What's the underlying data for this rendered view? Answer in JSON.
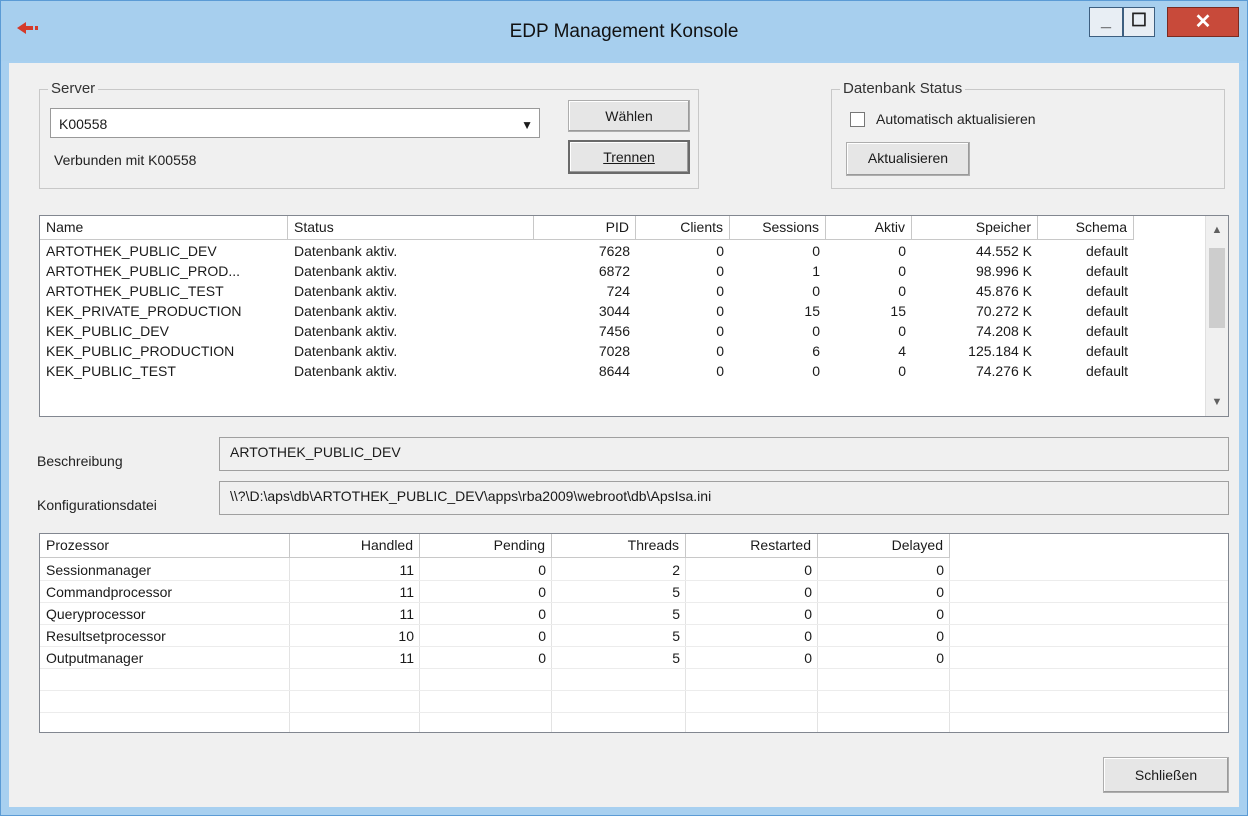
{
  "window": {
    "title": "EDP Management Konsole",
    "icon": "app-arrow-icon"
  },
  "server_group": {
    "label": "Server",
    "combo_value": "K00558",
    "connected_text": "Verbunden mit K00558",
    "select_button": "Wählen",
    "disconnect_button": "Trennen"
  },
  "db_status_group": {
    "label": "Datenbank Status",
    "auto_refresh_label": "Automatisch aktualisieren",
    "auto_refresh_checked": false,
    "refresh_button": "Aktualisieren"
  },
  "databases": {
    "columns": [
      "Name",
      "Status",
      "PID",
      "Clients",
      "Sessions",
      "Aktiv",
      "Speicher",
      "Schema"
    ],
    "rows": [
      [
        "ARTOTHEK_PUBLIC_DEV",
        "Datenbank aktiv.",
        "7628",
        "0",
        "0",
        "0",
        "44.552 K",
        "default"
      ],
      [
        "ARTOTHEK_PUBLIC_PROD...",
        "Datenbank aktiv.",
        "6872",
        "0",
        "1",
        "0",
        "98.996 K",
        "default"
      ],
      [
        "ARTOTHEK_PUBLIC_TEST",
        "Datenbank aktiv.",
        "724",
        "0",
        "0",
        "0",
        "45.876 K",
        "default"
      ],
      [
        "KEK_PRIVATE_PRODUCTION",
        "Datenbank aktiv.",
        "3044",
        "0",
        "15",
        "15",
        "70.272 K",
        "default"
      ],
      [
        "KEK_PUBLIC_DEV",
        "Datenbank aktiv.",
        "7456",
        "0",
        "0",
        "0",
        "74.208 K",
        "default"
      ],
      [
        "KEK_PUBLIC_PRODUCTION",
        "Datenbank aktiv.",
        "7028",
        "0",
        "6",
        "4",
        "125.184 K",
        "default"
      ],
      [
        "KEK_PUBLIC_TEST",
        "Datenbank aktiv.",
        "8644",
        "0",
        "0",
        "0",
        "74.276 K",
        "default"
      ]
    ]
  },
  "description": {
    "label": "Beschreibung",
    "value": "ARTOTHEK_PUBLIC_DEV"
  },
  "config_file": {
    "label": "Konfigurationsdatei",
    "value": "\\\\?\\D:\\aps\\db\\ARTOTHEK_PUBLIC_DEV\\apps\\rba2009\\webroot\\db\\ApsIsa.ini"
  },
  "processors": {
    "columns": [
      "Prozessor",
      "Handled",
      "Pending",
      "Threads",
      "Restarted",
      "Delayed"
    ],
    "rows": [
      [
        "Sessionmanager",
        "11",
        "0",
        "2",
        "0",
        "0"
      ],
      [
        "Commandprocessor",
        "11",
        "0",
        "5",
        "0",
        "0"
      ],
      [
        "Queryprocessor",
        "11",
        "0",
        "5",
        "0",
        "0"
      ],
      [
        "Resultsetprocessor",
        "10",
        "0",
        "5",
        "0",
        "0"
      ],
      [
        "Outputmanager",
        "11",
        "0",
        "5",
        "0",
        "0"
      ]
    ]
  },
  "close_button": "Schließen"
}
